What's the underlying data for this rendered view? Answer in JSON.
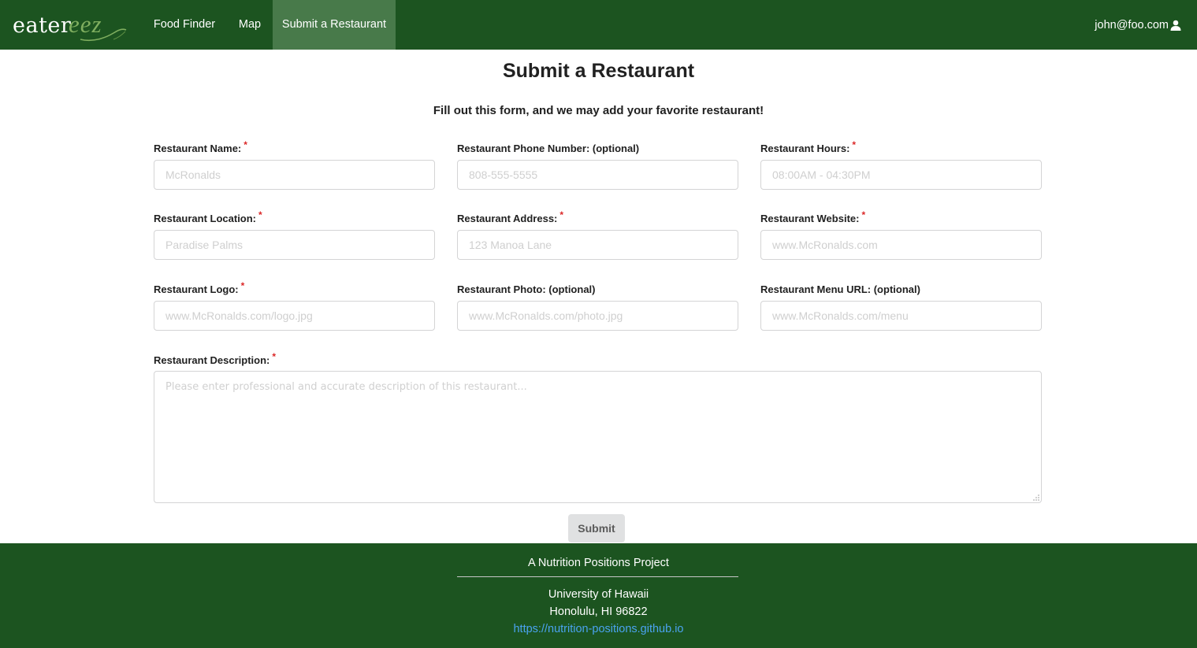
{
  "brand": {
    "text_main": "eater",
    "text_script": "eez"
  },
  "nav": {
    "items": [
      {
        "label": "Food Finder",
        "active": false
      },
      {
        "label": "Map",
        "active": false
      },
      {
        "label": "Submit a Restaurant",
        "active": true
      }
    ],
    "user_email": "john@foo.com",
    "user_icon": "user-icon"
  },
  "page": {
    "title": "Submit a Restaurant",
    "subtitle": "Fill out this form, and we may add your favorite restaurant!"
  },
  "form": {
    "fields": {
      "name": {
        "label": "Restaurant Name:",
        "required": true,
        "placeholder": "McRonalds",
        "value": ""
      },
      "phone": {
        "label": "Restaurant Phone Number: (optional)",
        "required": false,
        "placeholder": "808-555-5555",
        "value": ""
      },
      "hours": {
        "label": "Restaurant Hours:",
        "required": true,
        "placeholder": "08:00AM - 04:30PM",
        "value": ""
      },
      "location": {
        "label": "Restaurant Location:",
        "required": true,
        "placeholder": "Paradise Palms",
        "value": ""
      },
      "address": {
        "label": "Restaurant Address:",
        "required": true,
        "placeholder": "123 Manoa Lane",
        "value": ""
      },
      "website": {
        "label": "Restaurant Website:",
        "required": true,
        "placeholder": "www.McRonalds.com",
        "value": ""
      },
      "logo": {
        "label": "Restaurant Logo:",
        "required": true,
        "placeholder": "www.McRonalds.com/logo.jpg",
        "value": ""
      },
      "photo": {
        "label": "Restaurant Photo: (optional)",
        "required": false,
        "placeholder": "www.McRonalds.com/photo.jpg",
        "value": ""
      },
      "menu": {
        "label": "Restaurant Menu URL: (optional)",
        "required": false,
        "placeholder": "www.McRonalds.com/menu",
        "value": ""
      },
      "description": {
        "label": "Restaurant Description:",
        "required": true,
        "placeholder": "Please enter professional and accurate description of this restaurant...",
        "value": ""
      }
    },
    "required_marker": "*",
    "submit_label": "Submit"
  },
  "footer": {
    "line1": "A Nutrition Positions Project",
    "line2": "University of Hawaii",
    "line3": "Honolulu, HI 96822",
    "link": "https://nutrition-positions.github.io"
  },
  "colors": {
    "nav_bg": "#1c5420",
    "nav_active_bg": "#487a4a",
    "required": "#db2828",
    "link": "#4aa3f0",
    "button_bg": "#e0e1e2"
  }
}
